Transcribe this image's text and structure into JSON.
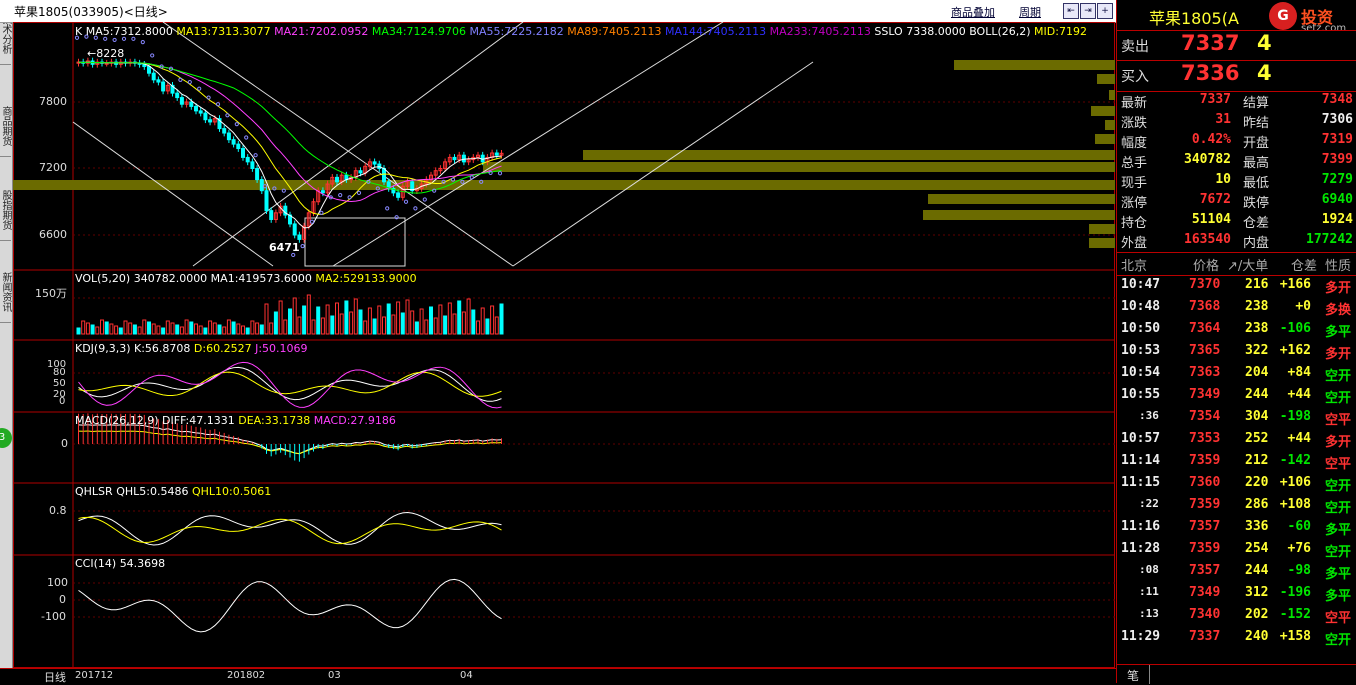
{
  "window": {
    "title": "苹果1805(033905)<日线>",
    "links": [
      "商品叠加",
      "周期"
    ],
    "nav_buttons": [
      "⇤",
      "⇥",
      "+",
      "−",
      "×"
    ]
  },
  "left_tabs": [
    "技术分析",
    "商品期货",
    "股指期货",
    "新闻资讯"
  ],
  "left_badge": "3",
  "kline": {
    "label": "K",
    "ma": [
      {
        "text": "MA5:7312.8000",
        "color": "#ffffff"
      },
      {
        "text": "MA13:7313.3077",
        "color": "#ffff00"
      },
      {
        "text": "MA21:7202.0952",
        "color": "#ff40ff"
      },
      {
        "text": "MA34:7124.9706",
        "color": "#00ff00"
      },
      {
        "text": "MA55:7225.2182",
        "color": "#8080ff"
      },
      {
        "text": "MA89:7405.2113",
        "color": "#ff8000"
      },
      {
        "text": "MA144:7405.2113",
        "color": "#3030ff"
      },
      {
        "text": "MA233:7405.2113",
        "color": "#c000c0"
      },
      {
        "text": "SSLO 7338.0000",
        "color": "#ffffff"
      },
      {
        "text": "BOLL(26,2)",
        "color": "#ffffff"
      },
      {
        "text": "MID:7192",
        "color": "#ffff00"
      }
    ],
    "yticks": [
      "7800",
      "7200",
      "6600"
    ],
    "high_label": "←8228",
    "low_label": "6471"
  },
  "vol": {
    "label": "VOL(5,20)",
    "values": [
      {
        "text": "340782.0000",
        "color": "#ffffff"
      },
      {
        "text": "MA1:419573.6000",
        "color": "#ffffff"
      },
      {
        "text": "MA2:529133.9000",
        "color": "#ffff00"
      }
    ],
    "ytick": "150万"
  },
  "kdj": {
    "label": "KDJ(9,3,3)",
    "values": [
      {
        "text": "K:56.8708",
        "color": "#ffffff"
      },
      {
        "text": "D:60.2527",
        "color": "#ffff00"
      },
      {
        "text": "J:50.1069",
        "color": "#ff40ff"
      }
    ],
    "yticks": [
      "100",
      "80",
      "50",
      "20",
      "0"
    ]
  },
  "macd": {
    "label": "MACD(26,12,9)",
    "values": [
      {
        "text": "DIFF:47.1331",
        "color": "#ffffff"
      },
      {
        "text": "DEA:33.1738",
        "color": "#ffff00"
      },
      {
        "text": "MACD:27.9186",
        "color": "#ff40ff"
      }
    ],
    "ytick": "0"
  },
  "qhlsr": {
    "label": "QHLSR",
    "values": [
      {
        "text": "QHL5:0.5486",
        "color": "#ffffff"
      },
      {
        "text": "QHL10:0.5061",
        "color": "#ffff00"
      }
    ],
    "ytick": "0.8"
  },
  "cci": {
    "label": "CCI(14)",
    "values": [
      {
        "text": "54.3698",
        "color": "#ffffff"
      }
    ],
    "yticks": [
      "100",
      "0",
      "-100"
    ]
  },
  "xaxis": {
    "period_label": "日线",
    "ticks": [
      "201712",
      "201802",
      "03",
      "04"
    ]
  },
  "quote": {
    "title": "苹果1805(A",
    "logo_text": "投资",
    "logo_sub": "setz.com",
    "sell_label": "卖出",
    "sell_price": "7337",
    "sell_qty": "4",
    "buy_label": "买入",
    "buy_price": "7336",
    "buy_qty": "4",
    "rows": [
      {
        "l1": "最新",
        "v1": "7337",
        "c1": "red",
        "l2": "结算",
        "v2": "7348",
        "c2": "red"
      },
      {
        "l1": "涨跌",
        "v1": "31",
        "c1": "red",
        "l2": "昨结",
        "v2": "7306",
        "c2": "white"
      },
      {
        "l1": "幅度",
        "v1": "0.42%",
        "c1": "red",
        "l2": "开盘",
        "v2": "7319",
        "c2": "red"
      },
      {
        "l1": "总手",
        "v1": "340782",
        "c1": "yellow",
        "l2": "最高",
        "v2": "7399",
        "c2": "red"
      },
      {
        "l1": "现手",
        "v1": "10",
        "c1": "yellow",
        "l2": "最低",
        "v2": "7279",
        "c2": "green"
      },
      {
        "l1": "涨停",
        "v1": "7672",
        "c1": "red",
        "l2": "跌停",
        "v2": "6940",
        "c2": "green"
      },
      {
        "l1": "持仓",
        "v1": "51104",
        "c1": "yellow",
        "l2": "仓差",
        "v2": "1924",
        "c2": "yellow"
      },
      {
        "l1": "外盘",
        "v1": "163540",
        "c1": "red",
        "l2": "内盘",
        "v2": "177242",
        "c2": "green"
      }
    ],
    "tick_header": [
      "北京",
      "价格",
      "↗/大单",
      "仓差",
      "性质"
    ],
    "ticks": [
      {
        "t": "10:47",
        "p": "7370",
        "v": "216",
        "d": "+166",
        "n": "多开",
        "nc": "red"
      },
      {
        "t": "10:48",
        "p": "7368",
        "v": "238",
        "d": "+0",
        "n": "多换",
        "nc": "red"
      },
      {
        "t": "10:50",
        "p": "7364",
        "v": "238",
        "d": "-106",
        "n": "多平",
        "nc": "green"
      },
      {
        "t": "10:53",
        "p": "7365",
        "v": "322",
        "d": "+162",
        "n": "多开",
        "nc": "red"
      },
      {
        "t": "10:54",
        "p": "7363",
        "v": "204",
        "d": "+84",
        "n": "空开",
        "nc": "green"
      },
      {
        "t": "10:55",
        "p": "7349",
        "v": "244",
        "d": "+44",
        "n": "空开",
        "nc": "green"
      },
      {
        "t": ":36",
        "p": "7354",
        "v": "304",
        "d": "-198",
        "n": "空平",
        "nc": "red"
      },
      {
        "t": "10:57",
        "p": "7353",
        "v": "252",
        "d": "+44",
        "n": "多开",
        "nc": "red"
      },
      {
        "t": "11:14",
        "p": "7359",
        "v": "212",
        "d": "-142",
        "n": "空平",
        "nc": "red"
      },
      {
        "t": "11:15",
        "p": "7360",
        "v": "220",
        "d": "+106",
        "n": "空开",
        "nc": "green"
      },
      {
        "t": ":22",
        "p": "7359",
        "v": "286",
        "d": "+108",
        "n": "空开",
        "nc": "green"
      },
      {
        "t": "11:16",
        "p": "7357",
        "v": "336",
        "d": "-60",
        "n": "多平",
        "nc": "green"
      },
      {
        "t": "11:28",
        "p": "7359",
        "v": "254",
        "d": "+76",
        "n": "空开",
        "nc": "green"
      },
      {
        "t": ":08",
        "p": "7357",
        "v": "244",
        "d": "-98",
        "n": "多平",
        "nc": "green"
      },
      {
        "t": ":11",
        "p": "7349",
        "v": "312",
        "d": "-196",
        "n": "多平",
        "nc": "green"
      },
      {
        "t": ":13",
        "p": "7340",
        "v": "202",
        "d": "-152",
        "n": "空平",
        "nc": "red"
      },
      {
        "t": "11:29",
        "p": "7337",
        "v": "240",
        "d": "+158",
        "n": "空开",
        "nc": "green"
      }
    ],
    "bottom_tab": "笔"
  },
  "colors": {
    "up": "#ff3232",
    "down": "#00ffff",
    "panel_border": "#b00000",
    "volume_profile": "#6b6b00"
  }
}
